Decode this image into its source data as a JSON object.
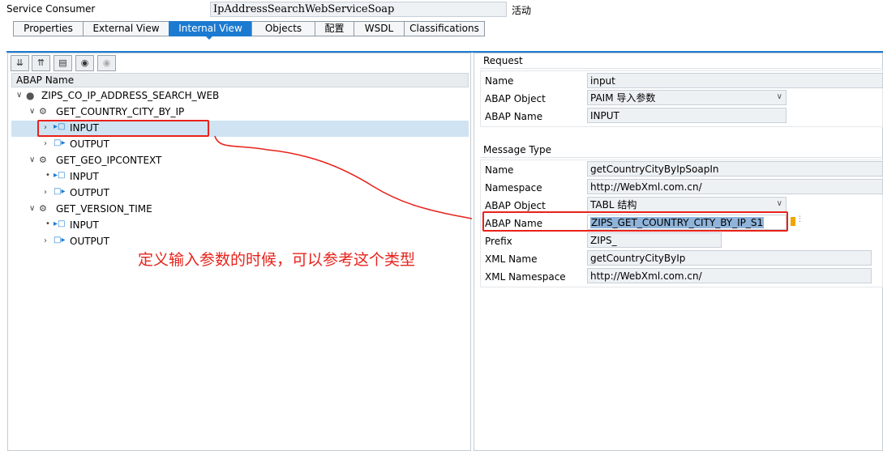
{
  "header": {
    "service_consumer_label": "Service Consumer",
    "service_consumer_value": "IpAddressSearchWebServiceSoap",
    "status": "活动"
  },
  "tabs": [
    {
      "label": "Properties"
    },
    {
      "label": "External View"
    },
    {
      "label": "Internal View"
    },
    {
      "label": "Objects"
    },
    {
      "label": "配置"
    },
    {
      "label": "WSDL"
    },
    {
      "label": "Classifications"
    }
  ],
  "active_tab": "Internal View",
  "tree": {
    "column_header": "ABAP Name",
    "root": "ZIPS_CO_IP_ADDRESS_SEARCH_WEB",
    "nodes": [
      {
        "label": "GET_COUNTRY_CITY_BY_IP"
      },
      {
        "label": "INPUT"
      },
      {
        "label": "OUTPUT"
      },
      {
        "label": "GET_GEO_IPCONTEXT"
      },
      {
        "label": "INPUT"
      },
      {
        "label": "OUTPUT"
      },
      {
        "label": "GET_VERSION_TIME"
      },
      {
        "label": "INPUT"
      },
      {
        "label": "OUTPUT"
      }
    ]
  },
  "annotation": "定义输入参数的时候，可以参考这个类型",
  "request": {
    "title": "Request",
    "rows": [
      {
        "label": "Name",
        "value": "input"
      },
      {
        "label": "ABAP Object",
        "value": "PAIM 导入参数"
      },
      {
        "label": "ABAP Name",
        "value": "INPUT"
      }
    ]
  },
  "message_type": {
    "title": "Message Type",
    "rows": [
      {
        "label": "Name",
        "value": "getCountryCityByIpSoapIn"
      },
      {
        "label": "Namespace",
        "value": "http://WebXml.com.cn/"
      },
      {
        "label": "ABAP Object",
        "value": "TABL 结构"
      },
      {
        "label": "ABAP Name",
        "value": "ZIPS_GET_COUNTRY_CITY_BY_IP_S1"
      },
      {
        "label": "Prefix",
        "value": "ZIPS_"
      },
      {
        "label": "XML Name",
        "value": "getCountryCityByIp"
      },
      {
        "label": "XML Namespace",
        "value": "http://WebXml.com.cn/"
      }
    ]
  },
  "colors": {
    "accent": "#1c7bd0",
    "highlight": "#cfe3f3",
    "annotation_red": "#e8221b"
  }
}
